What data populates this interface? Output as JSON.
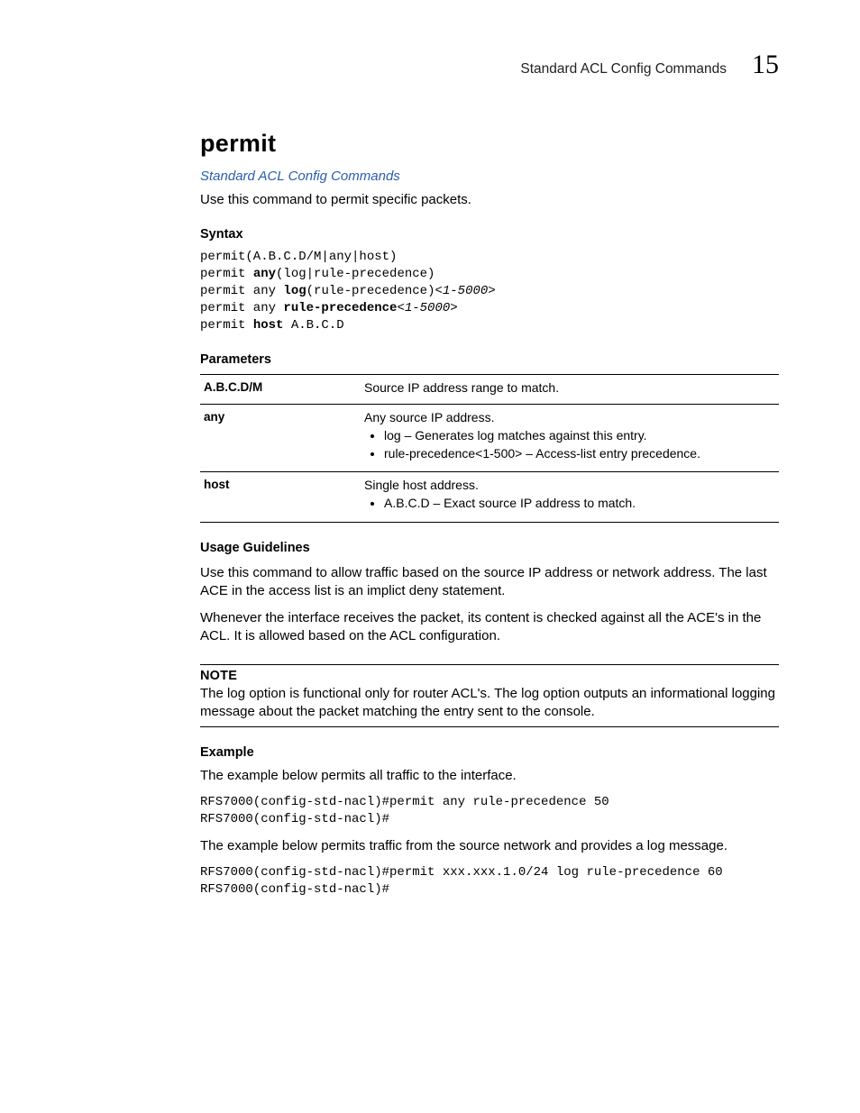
{
  "header": {
    "section": "Standard ACL Config Commands",
    "chapter_number": "15"
  },
  "title": "permit",
  "xref": "Standard ACL Config Commands",
  "intro": "Use this command to permit specific packets.",
  "syntax": {
    "heading": "Syntax",
    "lines": [
      {
        "segments": [
          {
            "t": "permit(A.B.C.D/M|any|host)"
          }
        ]
      },
      {
        "segments": [
          {
            "t": "permit "
          },
          {
            "t": "any",
            "kw": true
          },
          {
            "t": "(log|rule-precedence)"
          }
        ]
      },
      {
        "segments": [
          {
            "t": "permit any "
          },
          {
            "t": "log",
            "kw": true
          },
          {
            "t": "(rule-precedence)"
          },
          {
            "t": "<1-5000>",
            "arg": true
          }
        ]
      },
      {
        "segments": [
          {
            "t": "permit any "
          },
          {
            "t": "rule-precedence",
            "kw": true
          },
          {
            "t": "<1-5000>",
            "arg": true
          }
        ]
      },
      {
        "segments": [
          {
            "t": "permit "
          },
          {
            "t": "host",
            "kw": true
          },
          {
            "t": " A.B.C.D"
          }
        ]
      }
    ]
  },
  "parameters": {
    "heading": "Parameters",
    "rows": [
      {
        "key": "A.B.C.D/M",
        "desc": "Source IP address range to match.",
        "bullets": []
      },
      {
        "key": "any",
        "desc": "Any source IP address.",
        "bullets": [
          "log – Generates log matches against this entry.",
          "rule-precedence<1-500> – Access-list entry precedence."
        ]
      },
      {
        "key": "host",
        "desc": "Single host address.",
        "bullets": [
          "A.B.C.D – Exact source IP address to match."
        ]
      }
    ]
  },
  "usage": {
    "heading": "Usage Guidelines",
    "paras": [
      "Use this command to allow traffic based on the source IP address or network address. The last ACE in the access list is an implict deny statement.",
      "Whenever the interface receives the packet, its content is checked against all the ACE's in the ACL. It is allowed based on the ACL configuration."
    ]
  },
  "note": {
    "label": "NOTE",
    "text": "The log option is functional only for router ACL's. The log option outputs an informational logging message about the packet matching the entry sent to the console."
  },
  "example": {
    "heading": "Example",
    "intro1": "The example below permits all traffic to the interface.",
    "code1": "RFS7000(config-std-nacl)#permit any rule-precedence 50\nRFS7000(config-std-nacl)#",
    "intro2": "The example below permits traffic from the source network and provides a log message.",
    "code2": "RFS7000(config-std-nacl)#permit xxx.xxx.1.0/24 log rule-precedence 60\nRFS7000(config-std-nacl)#"
  }
}
